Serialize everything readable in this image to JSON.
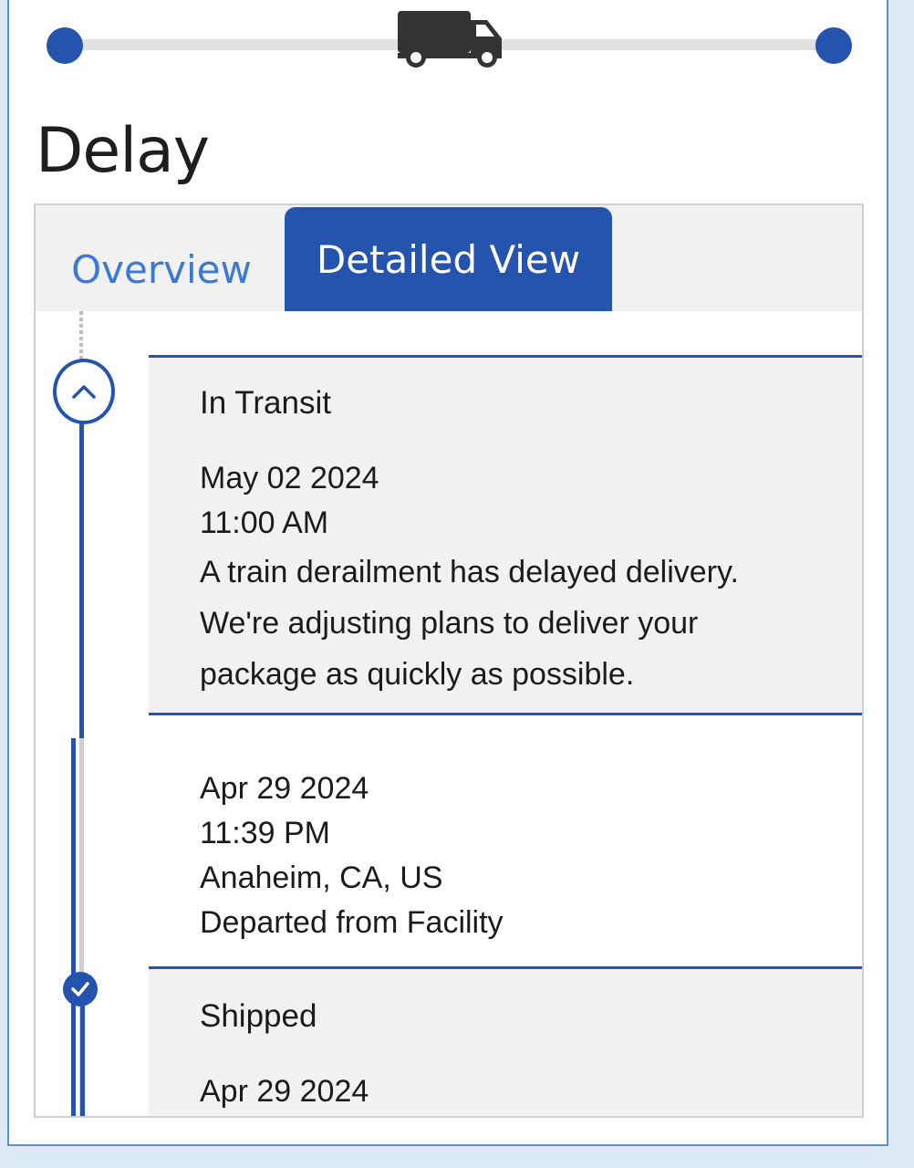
{
  "status": {
    "title": "Delay"
  },
  "progress": {
    "icon": "truck-icon",
    "accent": "#2454ad",
    "track_color": "#e1e1e1"
  },
  "tabs": {
    "overview_label": "Overview",
    "detailed_label": "Detailed View",
    "active": "Detailed View"
  },
  "events": [
    {
      "title": "In Transit",
      "date": "May 02 2024",
      "time": "11:00 AM",
      "message_lines": [
        "A train derailment has delayed delivery.",
        "We're adjusting plans to deliver your",
        "package as quickly as possible."
      ]
    },
    {
      "date": "Apr 29 2024",
      "time": "11:39 PM",
      "location": "Anaheim, CA, US",
      "description": "Departed from Facility"
    },
    {
      "title": "Shipped",
      "date": "Apr 29 2024"
    }
  ]
}
